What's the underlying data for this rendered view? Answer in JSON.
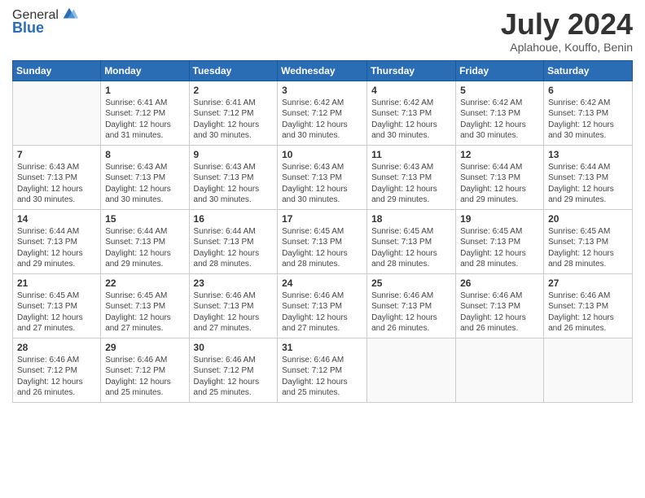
{
  "logo": {
    "general": "General",
    "blue": "Blue"
  },
  "title": "July 2024",
  "location": "Aplahoue, Kouffo, Benin",
  "days_of_week": [
    "Sunday",
    "Monday",
    "Tuesday",
    "Wednesday",
    "Thursday",
    "Friday",
    "Saturday"
  ],
  "weeks": [
    [
      {
        "day": "",
        "info": ""
      },
      {
        "day": "1",
        "info": "Sunrise: 6:41 AM\nSunset: 7:12 PM\nDaylight: 12 hours\nand 31 minutes."
      },
      {
        "day": "2",
        "info": "Sunrise: 6:41 AM\nSunset: 7:12 PM\nDaylight: 12 hours\nand 30 minutes."
      },
      {
        "day": "3",
        "info": "Sunrise: 6:42 AM\nSunset: 7:12 PM\nDaylight: 12 hours\nand 30 minutes."
      },
      {
        "day": "4",
        "info": "Sunrise: 6:42 AM\nSunset: 7:13 PM\nDaylight: 12 hours\nand 30 minutes."
      },
      {
        "day": "5",
        "info": "Sunrise: 6:42 AM\nSunset: 7:13 PM\nDaylight: 12 hours\nand 30 minutes."
      },
      {
        "day": "6",
        "info": "Sunrise: 6:42 AM\nSunset: 7:13 PM\nDaylight: 12 hours\nand 30 minutes."
      }
    ],
    [
      {
        "day": "7",
        "info": "Sunrise: 6:43 AM\nSunset: 7:13 PM\nDaylight: 12 hours\nand 30 minutes."
      },
      {
        "day": "8",
        "info": "Sunrise: 6:43 AM\nSunset: 7:13 PM\nDaylight: 12 hours\nand 30 minutes."
      },
      {
        "day": "9",
        "info": "Sunrise: 6:43 AM\nSunset: 7:13 PM\nDaylight: 12 hours\nand 30 minutes."
      },
      {
        "day": "10",
        "info": "Sunrise: 6:43 AM\nSunset: 7:13 PM\nDaylight: 12 hours\nand 30 minutes."
      },
      {
        "day": "11",
        "info": "Sunrise: 6:43 AM\nSunset: 7:13 PM\nDaylight: 12 hours\nand 29 minutes."
      },
      {
        "day": "12",
        "info": "Sunrise: 6:44 AM\nSunset: 7:13 PM\nDaylight: 12 hours\nand 29 minutes."
      },
      {
        "day": "13",
        "info": "Sunrise: 6:44 AM\nSunset: 7:13 PM\nDaylight: 12 hours\nand 29 minutes."
      }
    ],
    [
      {
        "day": "14",
        "info": "Sunrise: 6:44 AM\nSunset: 7:13 PM\nDaylight: 12 hours\nand 29 minutes."
      },
      {
        "day": "15",
        "info": "Sunrise: 6:44 AM\nSunset: 7:13 PM\nDaylight: 12 hours\nand 29 minutes."
      },
      {
        "day": "16",
        "info": "Sunrise: 6:44 AM\nSunset: 7:13 PM\nDaylight: 12 hours\nand 28 minutes."
      },
      {
        "day": "17",
        "info": "Sunrise: 6:45 AM\nSunset: 7:13 PM\nDaylight: 12 hours\nand 28 minutes."
      },
      {
        "day": "18",
        "info": "Sunrise: 6:45 AM\nSunset: 7:13 PM\nDaylight: 12 hours\nand 28 minutes."
      },
      {
        "day": "19",
        "info": "Sunrise: 6:45 AM\nSunset: 7:13 PM\nDaylight: 12 hours\nand 28 minutes."
      },
      {
        "day": "20",
        "info": "Sunrise: 6:45 AM\nSunset: 7:13 PM\nDaylight: 12 hours\nand 28 minutes."
      }
    ],
    [
      {
        "day": "21",
        "info": "Sunrise: 6:45 AM\nSunset: 7:13 PM\nDaylight: 12 hours\nand 27 minutes."
      },
      {
        "day": "22",
        "info": "Sunrise: 6:45 AM\nSunset: 7:13 PM\nDaylight: 12 hours\nand 27 minutes."
      },
      {
        "day": "23",
        "info": "Sunrise: 6:46 AM\nSunset: 7:13 PM\nDaylight: 12 hours\nand 27 minutes."
      },
      {
        "day": "24",
        "info": "Sunrise: 6:46 AM\nSunset: 7:13 PM\nDaylight: 12 hours\nand 27 minutes."
      },
      {
        "day": "25",
        "info": "Sunrise: 6:46 AM\nSunset: 7:13 PM\nDaylight: 12 hours\nand 26 minutes."
      },
      {
        "day": "26",
        "info": "Sunrise: 6:46 AM\nSunset: 7:13 PM\nDaylight: 12 hours\nand 26 minutes."
      },
      {
        "day": "27",
        "info": "Sunrise: 6:46 AM\nSunset: 7:13 PM\nDaylight: 12 hours\nand 26 minutes."
      }
    ],
    [
      {
        "day": "28",
        "info": "Sunrise: 6:46 AM\nSunset: 7:12 PM\nDaylight: 12 hours\nand 26 minutes."
      },
      {
        "day": "29",
        "info": "Sunrise: 6:46 AM\nSunset: 7:12 PM\nDaylight: 12 hours\nand 25 minutes."
      },
      {
        "day": "30",
        "info": "Sunrise: 6:46 AM\nSunset: 7:12 PM\nDaylight: 12 hours\nand 25 minutes."
      },
      {
        "day": "31",
        "info": "Sunrise: 6:46 AM\nSunset: 7:12 PM\nDaylight: 12 hours\nand 25 minutes."
      },
      {
        "day": "",
        "info": ""
      },
      {
        "day": "",
        "info": ""
      },
      {
        "day": "",
        "info": ""
      }
    ]
  ]
}
